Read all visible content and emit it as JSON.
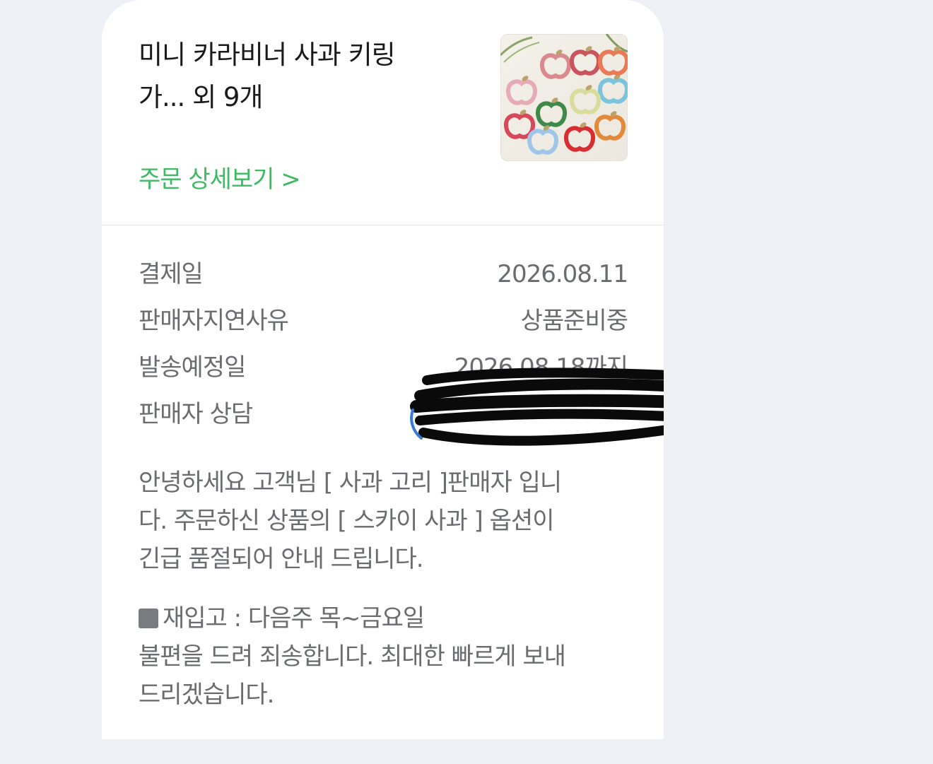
{
  "order": {
    "title_line1": "미니 카라비너 사과 키링",
    "title_line2": "가... 외 9개",
    "detail_link": "주문 상세보기 >",
    "thumbnail": {
      "description_icon": "apple-keyring-thumbnail",
      "apple_colors": [
        "#d98a8e",
        "#c9545e",
        "#e8aab4",
        "#7cc4dd",
        "#d8465a",
        "#3f8a4a",
        "#d9dc9a",
        "#9fc6e8",
        "#d82d31",
        "#e2893a",
        "#ea7a55",
        "#8a2b2f"
      ]
    }
  },
  "info": {
    "rows": [
      {
        "label": "결제일",
        "value": "2026.08.11"
      },
      {
        "label": "판매자지연사유",
        "value": "상품준비중"
      },
      {
        "label": "발송예정일",
        "value": "2026.08.18까지"
      },
      {
        "label": "판매자 상담",
        "value": ""
      }
    ]
  },
  "message": {
    "para1_line1": "안녕하세요 고객님 [ 사과 고리 ]판매자 입니",
    "para1_line2": "다. 주문하신 상품의 [ 스카이 사과 ] 옵션이",
    "para1_line3": "긴급 품절되어 안내 드립니다.",
    "para2_line1": "재입고 : 다음주 목~금요일",
    "para2_line2": "불편을 드려 죄송합니다. 최대한 빠르게 보내",
    "para2_line3": "드리겠습니다."
  },
  "colors": {
    "accent_green": "#3dbb63",
    "text_dark": "#1a1a1a",
    "text_gray": "#6b6c70",
    "background": "#eef0f5"
  }
}
